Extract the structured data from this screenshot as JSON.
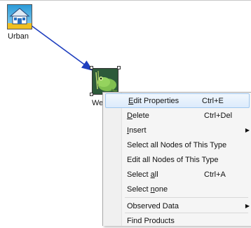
{
  "nodes": {
    "urban": {
      "label": "Urban",
      "icon": "house-icon"
    },
    "wetland": {
      "label": "We",
      "icon": "wetland-frog-icon"
    }
  },
  "context_menu": {
    "items": [
      {
        "label": "Edit Properties",
        "shortcut": "Ctrl+E",
        "submenu": false,
        "highlighted": true
      },
      {
        "label": "Delete",
        "shortcut": "Ctrl+Del",
        "submenu": false
      },
      {
        "label": "Insert",
        "shortcut": "",
        "submenu": true
      },
      {
        "label": "Select all Nodes of This Type",
        "shortcut": "",
        "submenu": false
      },
      {
        "label": "Edit all Nodes of This Type",
        "shortcut": "",
        "submenu": false
      },
      {
        "label": "Select all",
        "shortcut": "Ctrl+A",
        "submenu": false
      },
      {
        "label": "Select none",
        "shortcut": "",
        "submenu": false
      },
      {
        "label": "Observed Data",
        "shortcut": "",
        "submenu": true
      },
      {
        "label": "Find Products",
        "shortcut": "",
        "submenu": false
      }
    ]
  },
  "colors": {
    "connector": "#1f3fbf",
    "highlight_border": "#9fc7ef",
    "menu_background": "#f5f5f5"
  }
}
